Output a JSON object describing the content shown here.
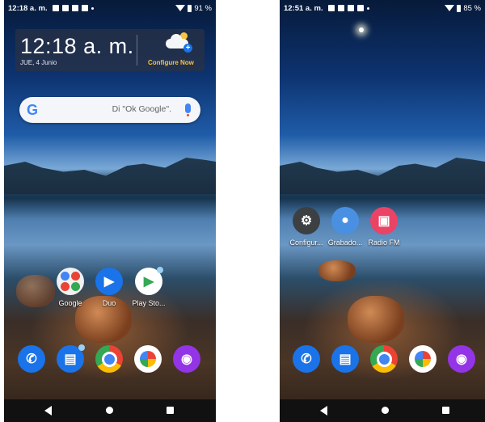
{
  "left": {
    "status": {
      "time": "12:18 a. m.",
      "battery": "91 %"
    },
    "widget": {
      "time": "12:18 a. m.",
      "date": "JUE, 4 Junio",
      "action": "Configure Now"
    },
    "search": {
      "logo": "G",
      "hint": "Di \"Ok Google\"."
    },
    "apps": [
      {
        "label": "Google"
      },
      {
        "label": "Duo"
      },
      {
        "label": "Play Sto..."
      }
    ],
    "dock": [
      {
        "icon": "phone-icon",
        "color": "#1a73e8"
      },
      {
        "icon": "messages-icon",
        "color": "#1a73e8"
      },
      {
        "icon": "chrome-icon",
        "color": "#ffffff"
      },
      {
        "icon": "photos-icon",
        "color": "#ffffff"
      },
      {
        "icon": "camera-icon",
        "color": "#9334e6"
      }
    ]
  },
  "right": {
    "status": {
      "time": "12:51 a. m.",
      "battery": "85 %"
    },
    "apps": [
      {
        "label": "Configur..."
      },
      {
        "label": "Grabado..."
      },
      {
        "label": "Radio FM"
      }
    ]
  },
  "colors": {
    "accent": "#1a73e8",
    "widget_action": "#f6c343",
    "camera": "#9334e6",
    "radio": "#ea4365"
  }
}
